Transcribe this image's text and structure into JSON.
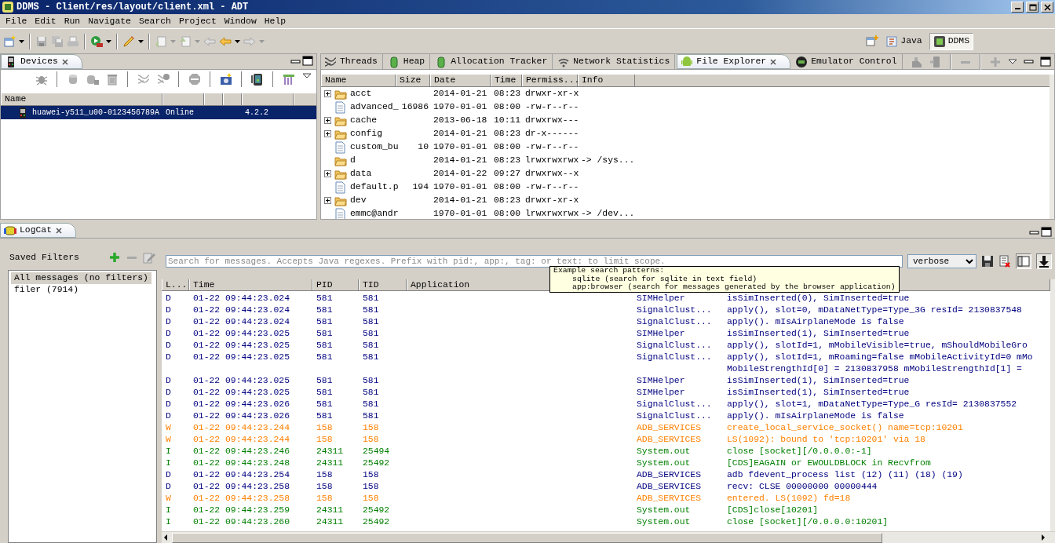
{
  "window": {
    "title": "DDMS - Client/res/layout/client.xml - ADT"
  },
  "menu": [
    "File",
    "Edit",
    "Run",
    "Navigate",
    "Search",
    "Project",
    "Window",
    "Help"
  ],
  "perspectives": [
    {
      "label": "Java",
      "kind": "java",
      "selected": false
    },
    {
      "label": "DDMS",
      "kind": "ddms",
      "selected": true
    }
  ],
  "devices": {
    "tab": "Devices",
    "columns": [
      "Name"
    ],
    "rows": [
      {
        "name": "huawei-y511_u00-0123456789A",
        "state": "Online",
        "version": "4.2.2",
        "selected": true
      }
    ]
  },
  "tool_tabs": [
    {
      "label": "Threads",
      "kind": "threads",
      "selected": false
    },
    {
      "label": "Heap",
      "kind": "heap",
      "selected": false
    },
    {
      "label": "Allocation Tracker",
      "kind": "allocation",
      "selected": false
    },
    {
      "label": "Network Statistics",
      "kind": "network",
      "selected": false
    },
    {
      "label": "File Explorer",
      "kind": "files",
      "selected": true
    },
    {
      "label": "Emulator Control",
      "kind": "emulator",
      "selected": false
    }
  ],
  "file_explorer": {
    "columns": [
      "Name",
      "Size",
      "Date",
      "Time",
      "Permiss...",
      "Info"
    ],
    "rows": [
      {
        "kind": "folder",
        "expanded": false,
        "name": "acct",
        "date": "2014-01-21",
        "time": "08:23",
        "permissions": "drwxr-xr-x"
      },
      {
        "kind": "file",
        "name": "advanced_",
        "size": "16986",
        "date": "1970-01-01",
        "time": "08:00",
        "permissions": "-rw-r--r--"
      },
      {
        "kind": "folder",
        "expanded": false,
        "name": "cache",
        "date": "2013-06-18",
        "time": "10:11",
        "permissions": "drwxrwx---"
      },
      {
        "kind": "folder",
        "expanded": false,
        "name": "config",
        "date": "2014-01-21",
        "time": "08:23",
        "permissions": "dr-x------"
      },
      {
        "kind": "file",
        "name": "custom_bu",
        "size": "10",
        "date": "1970-01-01",
        "time": "08:00",
        "permissions": "-rw-r--r--"
      },
      {
        "kind": "folder",
        "name": "d",
        "date": "2014-01-21",
        "time": "08:23",
        "permissions": "lrwxrwxrwx",
        "info": "-> /sys..."
      },
      {
        "kind": "folder",
        "expanded": false,
        "name": "data",
        "date": "2014-01-22",
        "time": "09:27",
        "permissions": "drwxrwx--x"
      },
      {
        "kind": "file",
        "name": "default.p",
        "size": "194",
        "date": "1970-01-01",
        "time": "08:00",
        "permissions": "-rw-r--r--"
      },
      {
        "kind": "folder",
        "expanded": false,
        "name": "dev",
        "date": "2014-01-21",
        "time": "08:23",
        "permissions": "drwxr-xr-x"
      },
      {
        "kind": "file",
        "name": "emmc@andr",
        "date": "1970-01-01",
        "time": "08:00",
        "permissions": "lrwxrwxrwx",
        "info": "-> /dev..."
      }
    ]
  },
  "logcat": {
    "tab": "LogCat",
    "saved_filters": {
      "title": "Saved Filters",
      "items": [
        {
          "label": "All messages (no filters)",
          "selected": true
        },
        {
          "label": "filer (7914)",
          "selected": false
        }
      ]
    },
    "search": {
      "placeholder": "Search for messages. Accepts Java regexes. Prefix with pid:, app:, tag: or text: to limit scope."
    },
    "level_select": "verbose",
    "tooltip": {
      "title": "Example search patterns:",
      "lines": [
        "sqlite (search for sqlite in text field)",
        "app:browser (search for messages generated by the browser application)"
      ]
    },
    "columns": [
      "L...",
      "Time",
      "PID",
      "TID",
      "Application"
    ],
    "rows": [
      {
        "kind": "debug",
        "level": "D",
        "time": "01-22 09:44:23.024",
        "pid": "581",
        "tid": "581",
        "tag": "SIMHelper",
        "text": "isSimInserted(0), SimInserted=true"
      },
      {
        "kind": "debug",
        "level": "D",
        "time": "01-22 09:44:23.024",
        "pid": "581",
        "tid": "581",
        "tag": "SignalClust...",
        "text": "apply(), slot=0, mDataNetType=Type_3G resId= 2130837548"
      },
      {
        "kind": "debug",
        "level": "D",
        "time": "01-22 09:44:23.024",
        "pid": "581",
        "tid": "581",
        "tag": "SignalClust...",
        "text": "apply(). mIsAirplaneMode is false"
      },
      {
        "kind": "debug",
        "level": "D",
        "time": "01-22 09:44:23.025",
        "pid": "581",
        "tid": "581",
        "tag": "SIMHelper",
        "text": "isSimInserted(1), SimInserted=true"
      },
      {
        "kind": "debug",
        "level": "D",
        "time": "01-22 09:44:23.025",
        "pid": "581",
        "tid": "581",
        "tag": "SignalClust...",
        "text": "apply(), slotId=1, mMobileVisible=true, mShouldMobileGro"
      },
      {
        "kind": "debug",
        "level": "D",
        "time": "01-22 09:44:23.025",
        "pid": "581",
        "tid": "581",
        "tag": "SignalClust...",
        "text": "apply(), slotId=1, mRoaming=false mMobileActivityId=0 mMo",
        "text_wrapped": "MobileStrengthId[0] = 2130837958 mMobileStrengthId[1] ="
      },
      {
        "kind": "debug",
        "level": "D",
        "time": "01-22 09:44:23.025",
        "pid": "581",
        "tid": "581",
        "tag": "SIMHelper",
        "text": "isSimInserted(1), SimInserted=true"
      },
      {
        "kind": "debug",
        "level": "D",
        "time": "01-22 09:44:23.025",
        "pid": "581",
        "tid": "581",
        "tag": "SIMHelper",
        "text": "isSimInserted(1), SimInserted=true"
      },
      {
        "kind": "debug",
        "level": "D",
        "time": "01-22 09:44:23.026",
        "pid": "581",
        "tid": "581",
        "tag": "SignalClust...",
        "text": "apply(), slot=1, mDataNetType=Type_G resId= 2130837552"
      },
      {
        "kind": "debug",
        "level": "D",
        "time": "01-22 09:44:23.026",
        "pid": "581",
        "tid": "581",
        "tag": "SignalClust...",
        "text": "apply(). mIsAirplaneMode is false"
      },
      {
        "kind": "warn",
        "level": "W",
        "time": "01-22 09:44:23.244",
        "pid": "158",
        "tid": "158",
        "tag": "ADB_SERVICES",
        "text": "create_local_service_socket() name=tcp:10201"
      },
      {
        "kind": "warn",
        "level": "W",
        "time": "01-22 09:44:23.244",
        "pid": "158",
        "tid": "158",
        "tag": "ADB_SERVICES",
        "text": "LS(1092): bound to 'tcp:10201' via 18"
      },
      {
        "kind": "info",
        "level": "I",
        "time": "01-22 09:44:23.246",
        "pid": "24311",
        "tid": "25494",
        "tag": "System.out",
        "text": "close [socket][/0.0.0.0:-1]"
      },
      {
        "kind": "info",
        "level": "I",
        "time": "01-22 09:44:23.248",
        "pid": "24311",
        "tid": "25492",
        "tag": "System.out",
        "text": "[CDS]EAGAIN or EWOULDBLOCK in Recvfrom"
      },
      {
        "kind": "debug",
        "level": "D",
        "time": "01-22 09:44:23.254",
        "pid": "158",
        "tid": "158",
        "tag": "ADB_SERVICES",
        "text": "adb fdevent_process list (12) (11) (18) (19)"
      },
      {
        "kind": "debug",
        "level": "D",
        "time": "01-22 09:44:23.258",
        "pid": "158",
        "tid": "158",
        "tag": "ADB_SERVICES",
        "text": "recv: CLSE 00000000 00000444"
      },
      {
        "kind": "warn",
        "level": "W",
        "time": "01-22 09:44:23.258",
        "pid": "158",
        "tid": "158",
        "tag": "ADB_SERVICES",
        "text": "entered. LS(1092) fd=18"
      },
      {
        "kind": "info",
        "level": "I",
        "time": "01-22 09:44:23.259",
        "pid": "24311",
        "tid": "25492",
        "tag": "System.out",
        "text": "[CDS]close[10201]"
      },
      {
        "kind": "info",
        "level": "I",
        "time": "01-22 09:44:23.260",
        "pid": "24311",
        "tid": "25492",
        "tag": "System.out",
        "text": "close [socket][/0.0.0.0:10201]"
      }
    ]
  }
}
